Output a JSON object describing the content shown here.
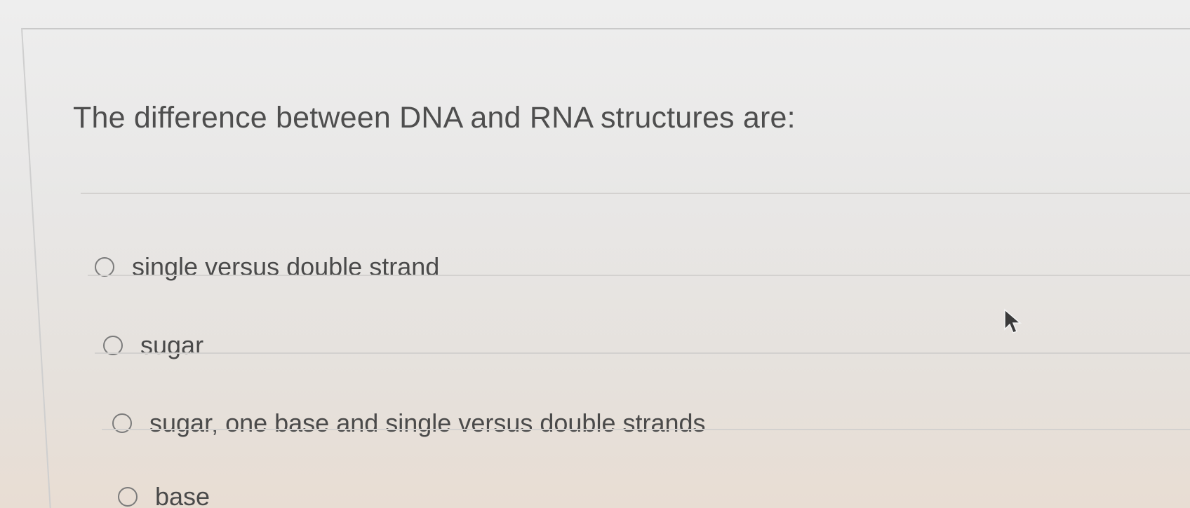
{
  "question": {
    "text": "The difference between DNA and RNA structures are:"
  },
  "answers": [
    {
      "label": "single versus double strand",
      "selected": false
    },
    {
      "label": "sugar",
      "selected": false
    },
    {
      "label": "sugar, one base and single versus double strands",
      "selected": false
    },
    {
      "label": "base",
      "selected": false
    }
  ],
  "icons": {
    "radio": "radio-unchecked-icon",
    "pointer": "mouse-pointer-icon"
  },
  "colors": {
    "text": "#4e4e4e",
    "radio_border": "#7b7b7b",
    "divider": "#d3d1cf"
  }
}
